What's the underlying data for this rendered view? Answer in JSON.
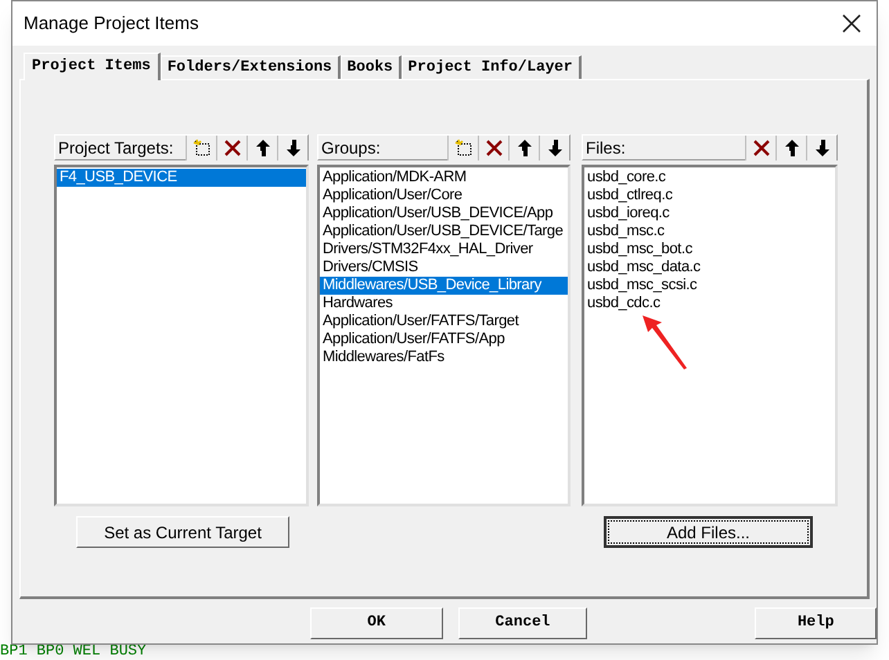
{
  "window": {
    "title": "Manage Project Items"
  },
  "tabs": [
    {
      "label": "Project Items",
      "selected": true
    },
    {
      "label": "Folders/Extensions",
      "selected": false
    },
    {
      "label": "Books",
      "selected": false
    },
    {
      "label": "Project Info/Layer",
      "selected": false
    }
  ],
  "panels": [
    {
      "label": "Project Targets:",
      "tools": [
        {
          "kind": "new"
        },
        {
          "kind": "delete"
        },
        {
          "kind": "up"
        },
        {
          "kind": "down"
        }
      ],
      "items": [
        {
          "text": "F4_USB_DEVICE",
          "selected": true
        }
      ],
      "button": {
        "label": "Set as Current Target",
        "focused": false
      }
    },
    {
      "label": "Groups:",
      "tools": [
        {
          "kind": "new"
        },
        {
          "kind": "delete"
        },
        {
          "kind": "up"
        },
        {
          "kind": "down"
        }
      ],
      "items": [
        {
          "text": "Application/MDK-ARM",
          "selected": false
        },
        {
          "text": "Application/User/Core",
          "selected": false
        },
        {
          "text": "Application/User/USB_DEVICE/App",
          "selected": false
        },
        {
          "text": "Application/User/USB_DEVICE/Targe",
          "selected": false
        },
        {
          "text": "Drivers/STM32F4xx_HAL_Driver",
          "selected": false
        },
        {
          "text": "Drivers/CMSIS",
          "selected": false
        },
        {
          "text": "Middlewares/USB_Device_Library",
          "selected": true
        },
        {
          "text": "Hardwares",
          "selected": false
        },
        {
          "text": "Application/User/FATFS/Target",
          "selected": false
        },
        {
          "text": "Application/User/FATFS/App",
          "selected": false
        },
        {
          "text": "Middlewares/FatFs",
          "selected": false
        }
      ]
    },
    {
      "label": "Files:",
      "tools": [
        {
          "kind": "delete"
        },
        {
          "kind": "up"
        },
        {
          "kind": "down"
        }
      ],
      "items": [
        {
          "text": "usbd_core.c",
          "selected": false
        },
        {
          "text": "usbd_ctlreq.c",
          "selected": false
        },
        {
          "text": "usbd_ioreq.c",
          "selected": false
        },
        {
          "text": "usbd_msc.c",
          "selected": false
        },
        {
          "text": "usbd_msc_bot.c",
          "selected": false
        },
        {
          "text": "usbd_msc_data.c",
          "selected": false
        },
        {
          "text": "usbd_msc_scsi.c",
          "selected": false
        },
        {
          "text": "usbd_cdc.c",
          "selected": false
        }
      ],
      "button": {
        "label": "Add Files...",
        "focused": true
      }
    }
  ],
  "buttons": [
    "OK",
    "Cancel",
    "Help"
  ],
  "background_code": "BP1 BP0 WEL BUSY"
}
